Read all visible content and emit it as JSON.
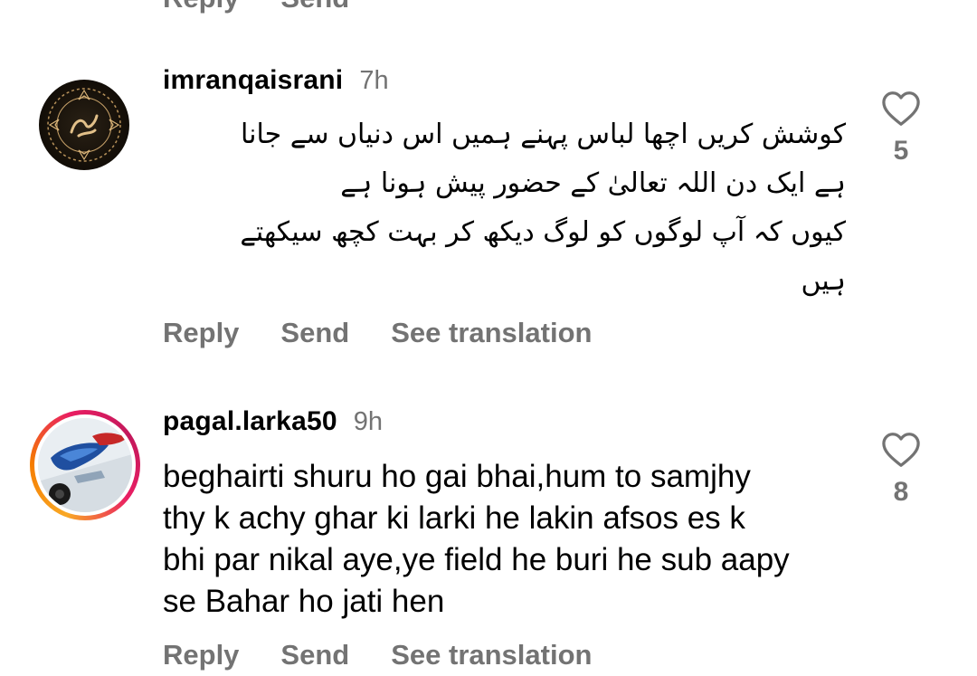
{
  "top_actions": {
    "reply": "Reply",
    "send": "Send"
  },
  "comments": [
    {
      "username": "imranqaisrani",
      "time": "7h",
      "avatar_icon": "calligraphy-emblem",
      "body_lines": [
        "کوشش کریں اچھا لباس پہنے ہمیں اس دنیاں سے جانا",
        "ہے ایک دن اللہ تعالیٰ کے حضور پیش ہونا ہے",
        "کیوں کہ آپ لوگوں کو لوگ دیکھ کر بہت کچھ سیکھتے",
        "ہیں"
      ],
      "likes": "5",
      "actions": {
        "reply": "Reply",
        "send": "Send",
        "translate": "See translation"
      }
    },
    {
      "username": "pagal.larka50",
      "time": "9h",
      "avatar_icon": "car-photo",
      "body_lines": [
        "beghairti shuru ho gai bhai,hum to samjhy",
        "thy k achy ghar ki larki he lakin afsos es k",
        "bhi par nikal aye,ye field he buri he sub aapy",
        "se Bahar ho jati hen"
      ],
      "likes": "8",
      "actions": {
        "reply": "Reply",
        "send": "Send",
        "translate": "See translation"
      }
    }
  ],
  "colors": {
    "secondary_text": "#737373",
    "story_ring": [
      "#f9a825",
      "#e91e63"
    ]
  }
}
